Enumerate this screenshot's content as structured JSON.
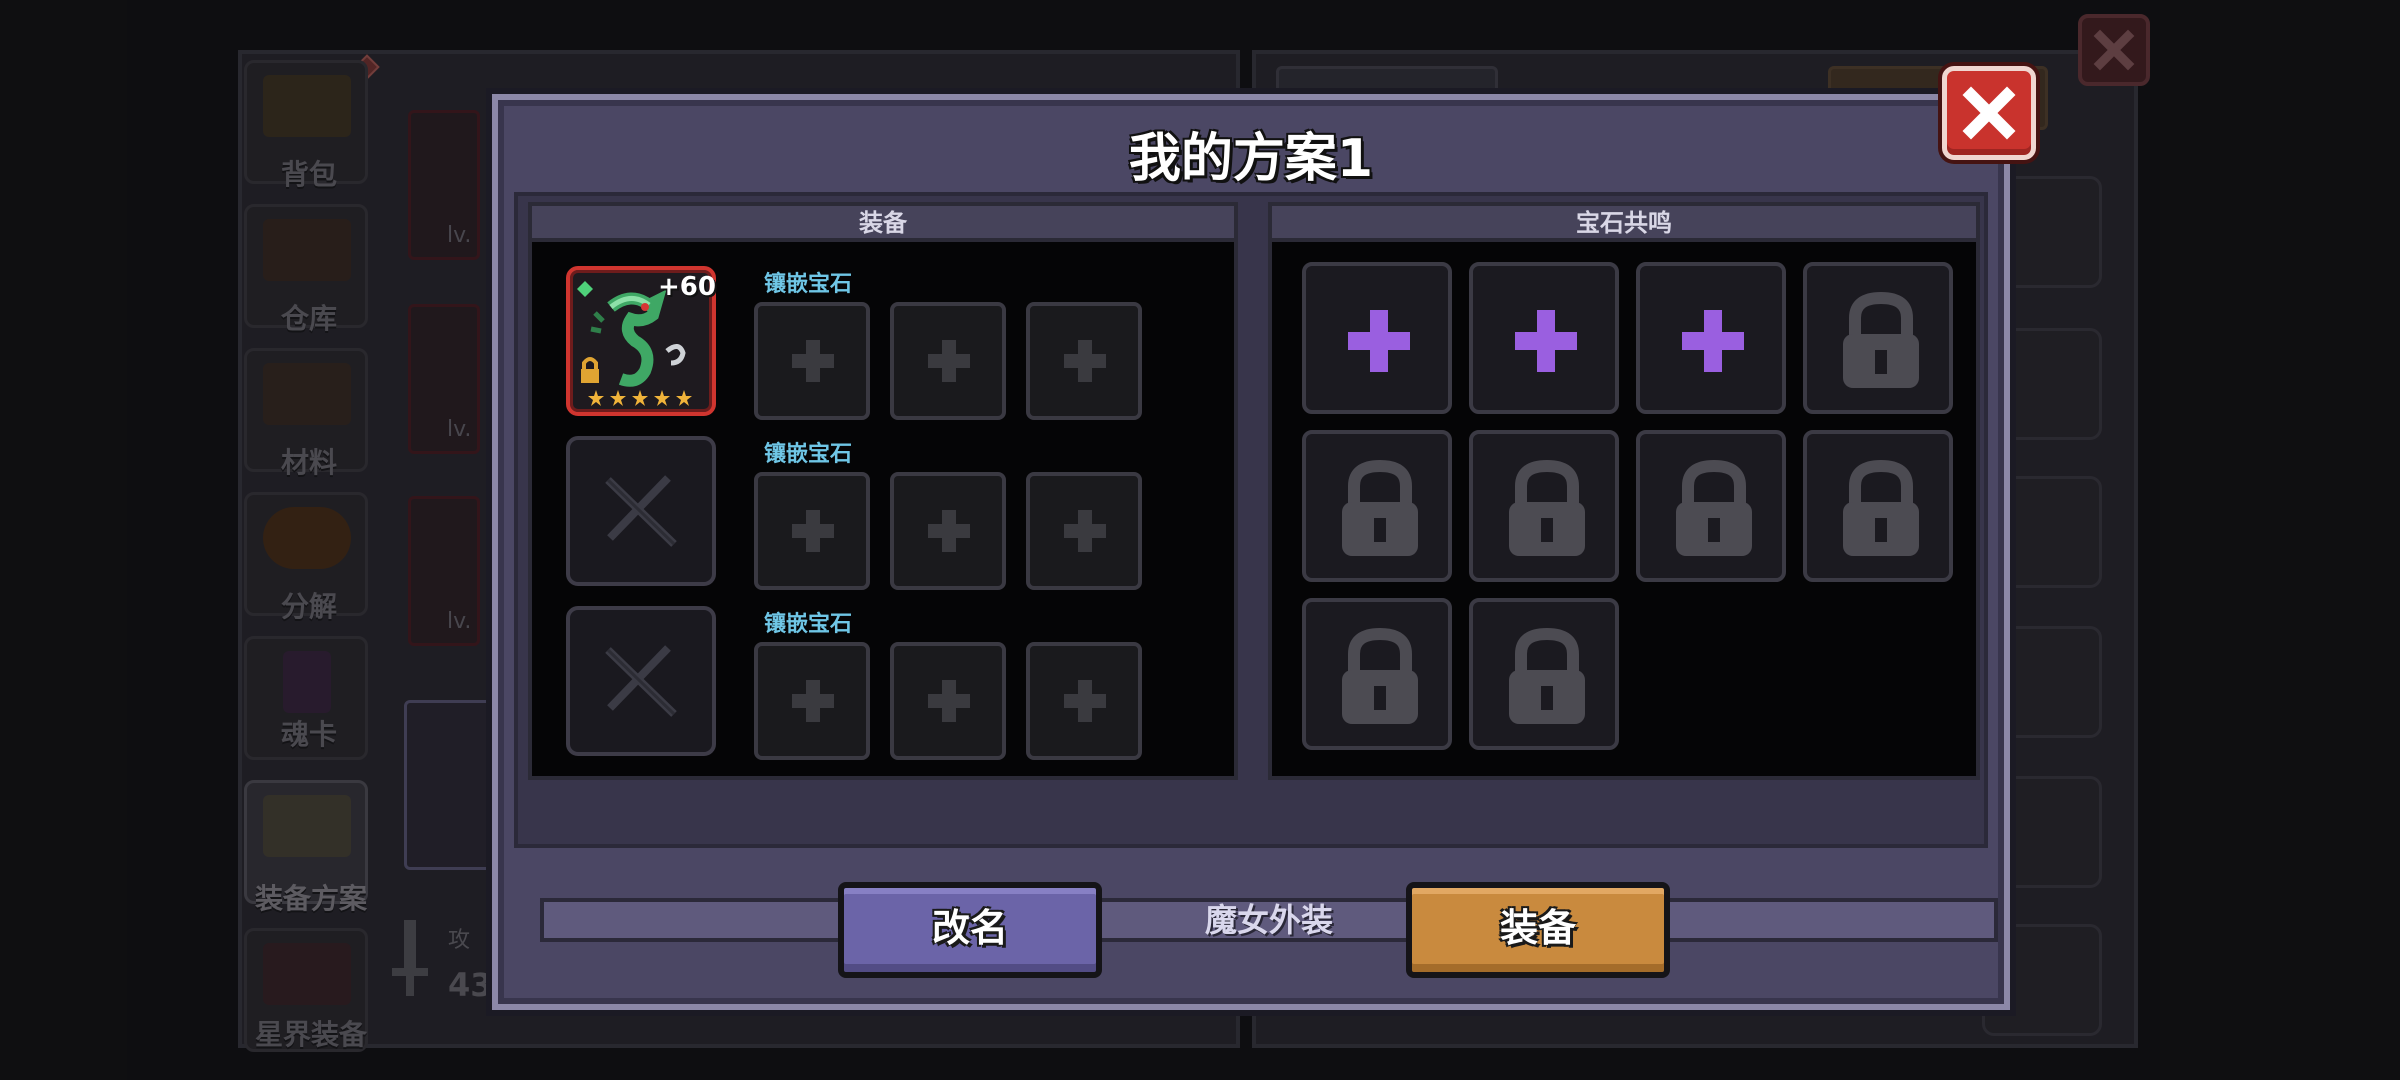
{
  "background": {
    "sidebar": [
      {
        "label": "背包",
        "icon": "chest-icon"
      },
      {
        "label": "仓库",
        "icon": "warehouse-chest-icon"
      },
      {
        "label": "材料",
        "icon": "materials-crate-icon"
      },
      {
        "label": "分解",
        "icon": "furnace-icon"
      },
      {
        "label": "魂卡",
        "icon": "soul-card-icon"
      },
      {
        "label": "装备方案",
        "icon": "armor-skull-icon"
      },
      {
        "label": "星界装备",
        "icon": "astral-mask-icon"
      }
    ],
    "list_cards": [
      {
        "level": "lv."
      },
      {
        "level": "lv."
      },
      {
        "level": "lv."
      }
    ],
    "stat": {
      "label": "攻",
      "value": "43"
    }
  },
  "modal": {
    "title": "我的方案1",
    "equipment_panel": {
      "header": "装备",
      "rows": [
        {
          "gem_label": "镶嵌宝石",
          "item": {
            "name": "green serpent weapon",
            "plus": "+60",
            "stars": 5,
            "locked": true,
            "equipped": true
          }
        },
        {
          "gem_label": "镶嵌宝石",
          "item": {
            "equipped": false
          }
        },
        {
          "gem_label": "镶嵌宝石",
          "item": {
            "equipped": false
          }
        }
      ]
    },
    "resonance_panel": {
      "header": "宝石共鸣",
      "slots": [
        "add",
        "add",
        "add",
        "locked",
        "locked",
        "locked",
        "locked",
        "locked",
        "locked",
        "locked"
      ]
    },
    "skin_bar": "魔女外装",
    "rename_button": "改名",
    "equip_button": "装备"
  },
  "colors": {
    "accent_purple": "#9a5fe0",
    "rename_button": "#6b64a8",
    "equip_button": "#c98a3e",
    "close_button": "#c9332d",
    "gem_label": "#6fc6e6"
  }
}
